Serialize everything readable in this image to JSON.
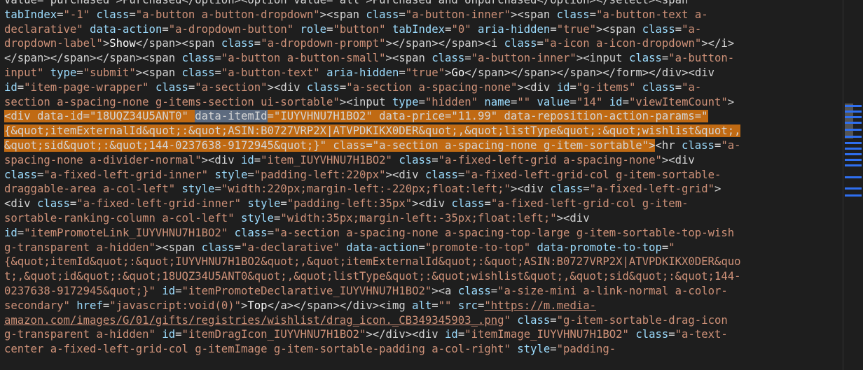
{
  "editor": {
    "lines": [
      [
        {
          "c": "t",
          "x": "value=\"purchased\">Purchased</option><option value=\"all\">Purchased and Unpurchased</option></select><span"
        }
      ],
      [
        {
          "c": "a",
          "x": "tabIndex"
        },
        {
          "c": "t",
          "x": "="
        },
        {
          "c": "v",
          "x": "\"-1\""
        },
        {
          "c": "t",
          "x": " "
        },
        {
          "c": "a",
          "x": "class"
        },
        {
          "c": "t",
          "x": "="
        },
        {
          "c": "v",
          "x": "\"a-button a-button-dropdown\""
        },
        {
          "c": "t",
          "x": "><span "
        },
        {
          "c": "a",
          "x": "class"
        },
        {
          "c": "t",
          "x": "="
        },
        {
          "c": "v",
          "x": "\"a-button-inner\""
        },
        {
          "c": "t",
          "x": "><span "
        },
        {
          "c": "a",
          "x": "class"
        },
        {
          "c": "t",
          "x": "="
        },
        {
          "c": "v",
          "x": "\"a-button-text a-"
        }
      ],
      [
        {
          "c": "v",
          "x": "declarative\""
        },
        {
          "c": "t",
          "x": " "
        },
        {
          "c": "a",
          "x": "data-action"
        },
        {
          "c": "t",
          "x": "="
        },
        {
          "c": "v",
          "x": "\"a-dropdown-button\""
        },
        {
          "c": "t",
          "x": " "
        },
        {
          "c": "a",
          "x": "role"
        },
        {
          "c": "t",
          "x": "="
        },
        {
          "c": "v",
          "x": "\"button\""
        },
        {
          "c": "t",
          "x": " "
        },
        {
          "c": "a",
          "x": "tabIndex"
        },
        {
          "c": "t",
          "x": "="
        },
        {
          "c": "v",
          "x": "\"0\""
        },
        {
          "c": "t",
          "x": " "
        },
        {
          "c": "a",
          "x": "aria-hidden"
        },
        {
          "c": "t",
          "x": "="
        },
        {
          "c": "v",
          "x": "\"true\""
        },
        {
          "c": "t",
          "x": "><span "
        },
        {
          "c": "a",
          "x": "class"
        },
        {
          "c": "t",
          "x": "="
        },
        {
          "c": "v",
          "x": "\"a-"
        }
      ],
      [
        {
          "c": "v",
          "x": "dropdown-label\""
        },
        {
          "c": "t",
          "x": ">"
        },
        {
          "c": "tx",
          "x": "Show"
        },
        {
          "c": "t",
          "x": "</span><span "
        },
        {
          "c": "a",
          "x": "class"
        },
        {
          "c": "t",
          "x": "="
        },
        {
          "c": "v",
          "x": "\"a-dropdown-prompt\""
        },
        {
          "c": "t",
          "x": "></span></span><i "
        },
        {
          "c": "a",
          "x": "class"
        },
        {
          "c": "t",
          "x": "="
        },
        {
          "c": "v",
          "x": "\"a-icon a-icon-dropdown\""
        },
        {
          "c": "t",
          "x": "></i>"
        }
      ],
      [
        {
          "c": "t",
          "x": "</span></span></span><span "
        },
        {
          "c": "a",
          "x": "class"
        },
        {
          "c": "t",
          "x": "="
        },
        {
          "c": "v",
          "x": "\"a-button a-button-small\""
        },
        {
          "c": "t",
          "x": "><span "
        },
        {
          "c": "a",
          "x": "class"
        },
        {
          "c": "t",
          "x": "="
        },
        {
          "c": "v",
          "x": "\"a-button-inner\""
        },
        {
          "c": "t",
          "x": "><input "
        },
        {
          "c": "a",
          "x": "class"
        },
        {
          "c": "t",
          "x": "="
        },
        {
          "c": "v",
          "x": "\"a-button-"
        }
      ],
      [
        {
          "c": "v",
          "x": "input\""
        },
        {
          "c": "t",
          "x": " "
        },
        {
          "c": "a",
          "x": "type"
        },
        {
          "c": "t",
          "x": "="
        },
        {
          "c": "v",
          "x": "\"submit\""
        },
        {
          "c": "t",
          "x": "><span "
        },
        {
          "c": "a",
          "x": "class"
        },
        {
          "c": "t",
          "x": "="
        },
        {
          "c": "v",
          "x": "\"a-button-text\""
        },
        {
          "c": "t",
          "x": " "
        },
        {
          "c": "a",
          "x": "aria-hidden"
        },
        {
          "c": "t",
          "x": "="
        },
        {
          "c": "v",
          "x": "\"true\""
        },
        {
          "c": "t",
          "x": ">"
        },
        {
          "c": "tx",
          "x": "Go"
        },
        {
          "c": "t",
          "x": "</span></span></span></form></div><div"
        }
      ],
      [
        {
          "c": "a",
          "x": "id"
        },
        {
          "c": "t",
          "x": "="
        },
        {
          "c": "v",
          "x": "\"item-page-wrapper\""
        },
        {
          "c": "t",
          "x": " "
        },
        {
          "c": "a",
          "x": "class"
        },
        {
          "c": "t",
          "x": "="
        },
        {
          "c": "v",
          "x": "\"a-section\""
        },
        {
          "c": "t",
          "x": "><div "
        },
        {
          "c": "a",
          "x": "class"
        },
        {
          "c": "t",
          "x": "="
        },
        {
          "c": "v",
          "x": "\"a-section a-spacing-none\""
        },
        {
          "c": "t",
          "x": "><div "
        },
        {
          "c": "a",
          "x": "id"
        },
        {
          "c": "t",
          "x": "="
        },
        {
          "c": "v",
          "x": "\"g-items\""
        },
        {
          "c": "t",
          "x": " "
        },
        {
          "c": "a",
          "x": "class"
        },
        {
          "c": "t",
          "x": "="
        },
        {
          "c": "v",
          "x": "\"a-"
        }
      ],
      [
        {
          "c": "v",
          "x": "section a-spacing-none g-items-section ui-sortable\""
        },
        {
          "c": "t",
          "x": "><input "
        },
        {
          "c": "a",
          "x": "type"
        },
        {
          "c": "t",
          "x": "="
        },
        {
          "c": "v",
          "x": "\"hidden\""
        },
        {
          "c": "t",
          "x": " "
        },
        {
          "c": "a",
          "x": "name"
        },
        {
          "c": "t",
          "x": "="
        },
        {
          "c": "v",
          "x": "\"\""
        },
        {
          "c": "t",
          "x": " "
        },
        {
          "c": "a",
          "x": "value"
        },
        {
          "c": "t",
          "x": "="
        },
        {
          "c": "v",
          "x": "\"14\""
        },
        {
          "c": "t",
          "x": " "
        },
        {
          "c": "a",
          "x": "id"
        },
        {
          "c": "t",
          "x": "="
        },
        {
          "c": "v",
          "x": "\"viewItemCount\""
        },
        {
          "c": "t",
          "x": ">"
        }
      ],
      [
        {
          "c": "hl",
          "x": "<div data-id=\"18UQZ34U5ANT0\" "
        },
        {
          "c": "hlsel",
          "x": "data-itemId"
        },
        {
          "c": "hl",
          "x": "=\"IUYVHNU7H1BO2\" data-price=\"11.99\" data-reposition-action-params=\""
        }
      ],
      [
        {
          "c": "hl",
          "x": "{&quot;itemExternalId&quot;:&quot;ASIN:B0727VRP2X|ATVPDKIKX0DER&quot;,&quot;listType&quot;:&quot;wishlist&quot;,"
        }
      ],
      [
        {
          "c": "hl",
          "x": "&quot;sid&quot;:&quot;144-0237638-9172945&quot;}\" class=\"a-section a-spacing-none g-item-sortable\">"
        },
        {
          "c": "t",
          "x": "<hr "
        },
        {
          "c": "a",
          "x": "class"
        },
        {
          "c": "t",
          "x": "="
        },
        {
          "c": "v",
          "x": "\"a-"
        }
      ],
      [
        {
          "c": "v",
          "x": "spacing-none a-divider-normal\""
        },
        {
          "c": "t",
          "x": "><div "
        },
        {
          "c": "a",
          "x": "id"
        },
        {
          "c": "t",
          "x": "="
        },
        {
          "c": "v",
          "x": "\"item_IUYVHNU7H1BO2\""
        },
        {
          "c": "t",
          "x": " "
        },
        {
          "c": "a",
          "x": "class"
        },
        {
          "c": "t",
          "x": "="
        },
        {
          "c": "v",
          "x": "\"a-fixed-left-grid a-spacing-none\""
        },
        {
          "c": "t",
          "x": "><div"
        }
      ],
      [
        {
          "c": "a",
          "x": "class"
        },
        {
          "c": "t",
          "x": "="
        },
        {
          "c": "v",
          "x": "\"a-fixed-left-grid-inner\""
        },
        {
          "c": "t",
          "x": " "
        },
        {
          "c": "a",
          "x": "style"
        },
        {
          "c": "t",
          "x": "="
        },
        {
          "c": "v",
          "x": "\"padding-left:220px\""
        },
        {
          "c": "t",
          "x": "><div "
        },
        {
          "c": "a",
          "x": "class"
        },
        {
          "c": "t",
          "x": "="
        },
        {
          "c": "v",
          "x": "\"a-fixed-left-grid-col g-item-sortable-"
        }
      ],
      [
        {
          "c": "v",
          "x": "draggable-area a-col-left\""
        },
        {
          "c": "t",
          "x": " "
        },
        {
          "c": "a",
          "x": "style"
        },
        {
          "c": "t",
          "x": "="
        },
        {
          "c": "v",
          "x": "\"width:220px;margin-left:-220px;float:left;\""
        },
        {
          "c": "t",
          "x": "><div "
        },
        {
          "c": "a",
          "x": "class"
        },
        {
          "c": "t",
          "x": "="
        },
        {
          "c": "v",
          "x": "\"a-fixed-left-grid\""
        },
        {
          "c": "t",
          "x": ">"
        }
      ],
      [
        {
          "c": "t",
          "x": "<div "
        },
        {
          "c": "a",
          "x": "class"
        },
        {
          "c": "t",
          "x": "="
        },
        {
          "c": "v",
          "x": "\"a-fixed-left-grid-inner\""
        },
        {
          "c": "t",
          "x": " "
        },
        {
          "c": "a",
          "x": "style"
        },
        {
          "c": "t",
          "x": "="
        },
        {
          "c": "v",
          "x": "\"padding-left:35px\""
        },
        {
          "c": "t",
          "x": "><div "
        },
        {
          "c": "a",
          "x": "class"
        },
        {
          "c": "t",
          "x": "="
        },
        {
          "c": "v",
          "x": "\"a-fixed-left-grid-col g-item-"
        }
      ],
      [
        {
          "c": "v",
          "x": "sortable-ranking-column a-col-left\""
        },
        {
          "c": "t",
          "x": " "
        },
        {
          "c": "a",
          "x": "style"
        },
        {
          "c": "t",
          "x": "="
        },
        {
          "c": "v",
          "x": "\"width:35px;margin-left:-35px;float:left;\""
        },
        {
          "c": "t",
          "x": "><div"
        }
      ],
      [
        {
          "c": "a",
          "x": "id"
        },
        {
          "c": "t",
          "x": "="
        },
        {
          "c": "v",
          "x": "\"itemPromoteLink_IUYVHNU7H1BO2\""
        },
        {
          "c": "t",
          "x": " "
        },
        {
          "c": "a",
          "x": "class"
        },
        {
          "c": "t",
          "x": "="
        },
        {
          "c": "v",
          "x": "\"a-section a-spacing-none a-spacing-top-large g-item-sortable-top-wish"
        }
      ],
      [
        {
          "c": "v",
          "x": "g-transparent a-hidden\""
        },
        {
          "c": "t",
          "x": "><span "
        },
        {
          "c": "a",
          "x": "class"
        },
        {
          "c": "t",
          "x": "="
        },
        {
          "c": "v",
          "x": "\"a-declarative\""
        },
        {
          "c": "t",
          "x": " "
        },
        {
          "c": "a",
          "x": "data-action"
        },
        {
          "c": "t",
          "x": "="
        },
        {
          "c": "v",
          "x": "\"promote-to-top\""
        },
        {
          "c": "t",
          "x": " "
        },
        {
          "c": "a",
          "x": "data-promote-to-top"
        },
        {
          "c": "t",
          "x": "="
        },
        {
          "c": "v",
          "x": "\""
        }
      ],
      [
        {
          "c": "v",
          "x": "{&quot;itemId&quot;:&quot;IUYVHNU7H1BO2&quot;,&quot;itemExternalId&quot;:&quot;ASIN:B0727VRP2X|ATVPDKIKX0DER&quo"
        }
      ],
      [
        {
          "c": "v",
          "x": "t;,&quot;id&quot;:&quot;18UQZ34U5ANT0&quot;,&quot;listType&quot;:&quot;wishlist&quot;,&quot;sid&quot;:&quot;144-"
        }
      ],
      [
        {
          "c": "v",
          "x": "0237638-9172945&quot;}\""
        },
        {
          "c": "t",
          "x": " "
        },
        {
          "c": "a",
          "x": "id"
        },
        {
          "c": "t",
          "x": "="
        },
        {
          "c": "v",
          "x": "\"itemPromoteDeclarative_IUYVHNU7H1BO2\""
        },
        {
          "c": "t",
          "x": "><a "
        },
        {
          "c": "a",
          "x": "class"
        },
        {
          "c": "t",
          "x": "="
        },
        {
          "c": "v",
          "x": "\"a-size-mini a-link-normal a-color-"
        }
      ],
      [
        {
          "c": "v",
          "x": "secondary\""
        },
        {
          "c": "t",
          "x": " "
        },
        {
          "c": "a",
          "x": "href"
        },
        {
          "c": "t",
          "x": "="
        },
        {
          "c": "v",
          "x": "\"javascript:void(0)\""
        },
        {
          "c": "t",
          "x": ">"
        },
        {
          "c": "tx",
          "x": "Top"
        },
        {
          "c": "t",
          "x": "</a></span></div><img "
        },
        {
          "c": "a",
          "x": "alt"
        },
        {
          "c": "t",
          "x": "="
        },
        {
          "c": "v",
          "x": "\"\""
        },
        {
          "c": "t",
          "x": " "
        },
        {
          "c": "a",
          "x": "src"
        },
        {
          "c": "t",
          "x": "="
        },
        {
          "c": "lnk",
          "x": "\"https://m.media-"
        }
      ],
      [
        {
          "c": "lnk",
          "x": "amazon.com/images/G/01/gifts/registries/wishlist/drag_icon._CB349345903_.png"
        },
        {
          "c": "v",
          "x": "\""
        },
        {
          "c": "t",
          "x": " "
        },
        {
          "c": "a",
          "x": "class"
        },
        {
          "c": "t",
          "x": "="
        },
        {
          "c": "v",
          "x": "\"g-item-sortable-drag-icon"
        }
      ],
      [
        {
          "c": "v",
          "x": "g-transparent a-hidden\""
        },
        {
          "c": "t",
          "x": " "
        },
        {
          "c": "a",
          "x": "id"
        },
        {
          "c": "t",
          "x": "="
        },
        {
          "c": "v",
          "x": "\"itemDragIcon_IUYVHNU7H1BO2\""
        },
        {
          "c": "t",
          "x": "></div><div "
        },
        {
          "c": "a",
          "x": "id"
        },
        {
          "c": "t",
          "x": "="
        },
        {
          "c": "v",
          "x": "\"itemImage_IUYVHNU7H1BO2\""
        },
        {
          "c": "t",
          "x": " "
        },
        {
          "c": "a",
          "x": "class"
        },
        {
          "c": "t",
          "x": "="
        },
        {
          "c": "v",
          "x": "\"a-text-"
        }
      ],
      [
        {
          "c": "v",
          "x": "center a-fixed-left-grid-col g-itemImage g-item-sortable-padding a-col-right\""
        },
        {
          "c": "t",
          "x": " "
        },
        {
          "c": "a",
          "x": "style"
        },
        {
          "c": "t",
          "x": "="
        },
        {
          "c": "v",
          "x": "\"padding-"
        }
      ]
    ]
  },
  "colors": {
    "background": "#1e1e1e",
    "highlight": "#c06a13",
    "selection": "#5d6b7f",
    "scroll_marker": "#2f6ff0"
  }
}
